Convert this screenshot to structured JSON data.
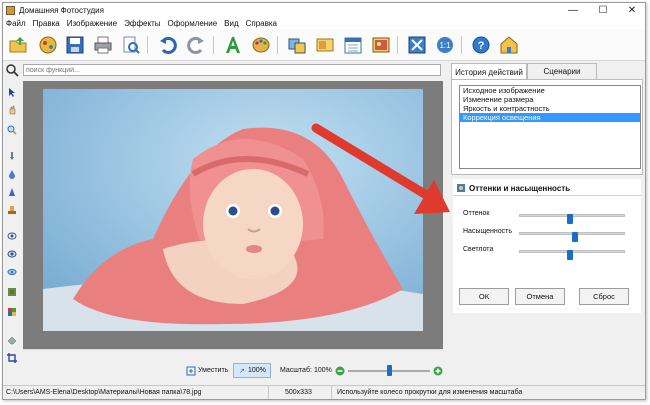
{
  "window": {
    "title": "Домашняя Фотостудия",
    "minimize": "—",
    "maximize": "☐",
    "close": "✕"
  },
  "menu": [
    "Файл",
    "Правка",
    "Изображение",
    "Эффекты",
    "Оформление",
    "Вид",
    "Справка"
  ],
  "search": {
    "placeholder": "поиск функций..."
  },
  "panel": {
    "tabs": [
      "История действий",
      "Сценарии"
    ],
    "history": [
      "Исходное изображение",
      "Изменение размера",
      "Яркость и контрастность",
      "Коррекция освещения"
    ],
    "history_selected": 3,
    "adjust_title": "Оттенки и насыщенность",
    "sliders": [
      {
        "label": "Оттенок",
        "value": 0.5
      },
      {
        "label": "Насыщенность",
        "value": 0.55
      },
      {
        "label": "Светлота",
        "value": 0.5
      }
    ],
    "buttons": {
      "ok": "ОК",
      "cancel": "Отмена",
      "reset": "Сброс"
    }
  },
  "bottom": {
    "fit": "Уместить",
    "actual": "100%",
    "zoom_label": "Масштаб:",
    "zoom_value": "100%",
    "zoom_level": 0.5
  },
  "status": {
    "path": "C:\\Users\\AMS-Elena\\Desktop\\Материалы\\Новая папка\\78.jpg",
    "size": "500x333",
    "hint": "Используйте колесо прокрутки для изменения масштаба"
  },
  "colors": {
    "accent": "#3399ff",
    "arrow": "#e03a2f",
    "slider": "#1b6ec7"
  }
}
